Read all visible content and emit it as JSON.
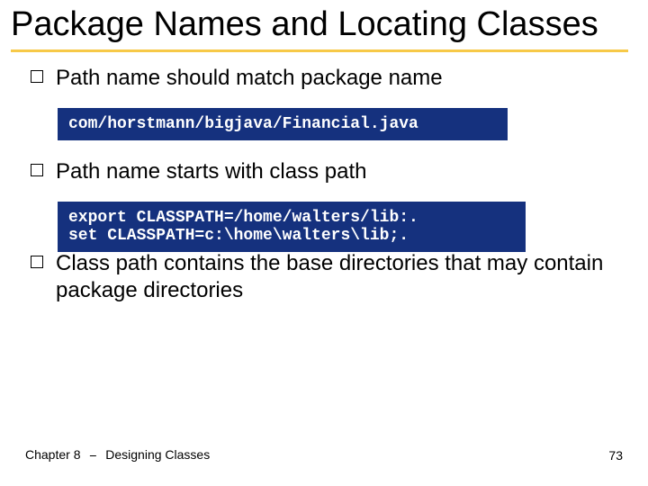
{
  "title": "Package Names and Locating Classes",
  "bullets": [
    "Path name should match package name",
    "Path name starts with class path",
    "Class path contains the base directories that may contain package directories"
  ],
  "code1": "com/horstmann/bigjava/Financial.java",
  "code2": "export CLASSPATH=/home/walters/lib:.\nset CLASSPATH=c:\\home\\walters\\lib;.",
  "footer": {
    "chapter": "Chapter 8",
    "sep": "⎯",
    "topic": "Designing Classes",
    "page": "73"
  }
}
